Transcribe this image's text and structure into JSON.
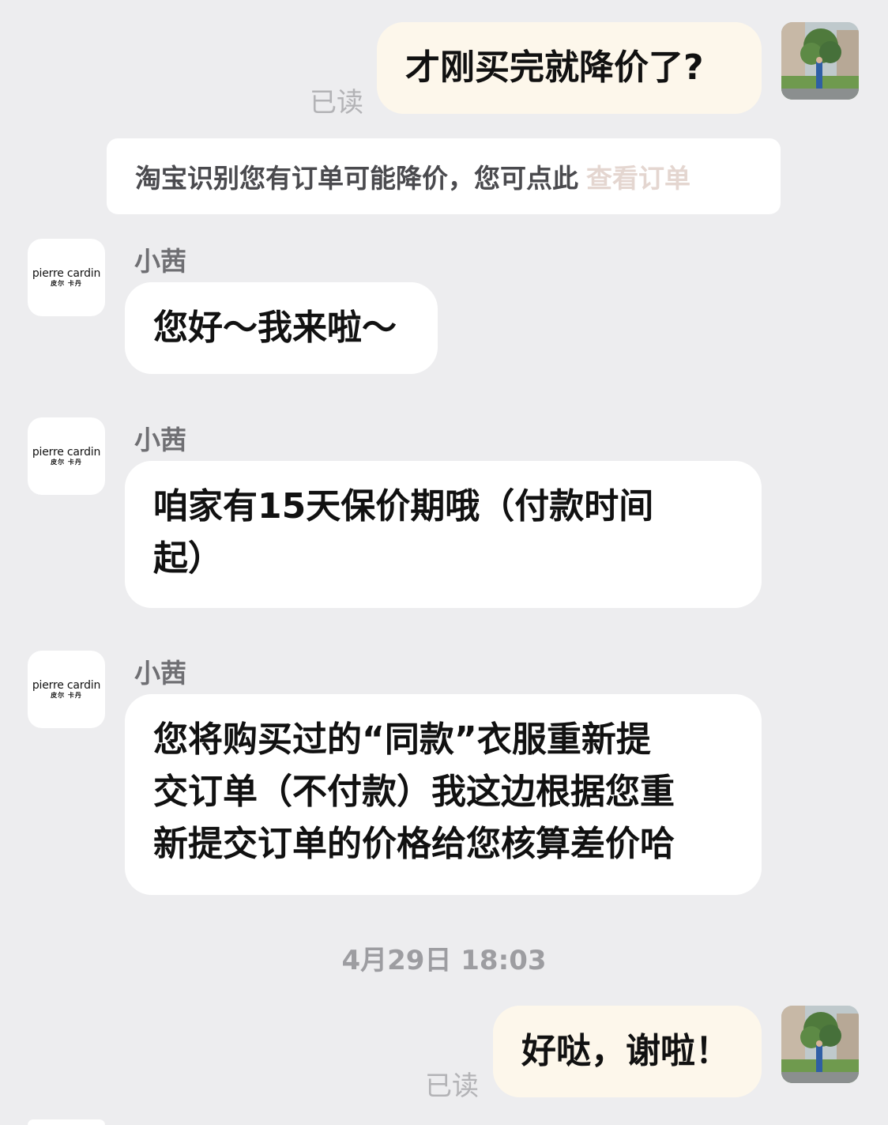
{
  "messages": {
    "m1": {
      "text": "才刚买完就降价了?",
      "status": "已读"
    },
    "notice": {
      "text": "淘宝识别您有订单可能降价，您可点此",
      "link": "查看订单"
    },
    "m2": {
      "sender": "小茜",
      "text": "您好～我来啦～"
    },
    "m3": {
      "sender": "小茜",
      "line1": "咱家有15天保价期哦（付款时间",
      "line2": "起）"
    },
    "m4": {
      "sender": "小茜",
      "line1": "您将购买过的“同款”衣服重新提",
      "line2": "交订单（不付款）我这边根据您重",
      "line3": "新提交订单的价格给您核算差价哈"
    },
    "timestamp": "4月29日 18:03",
    "m5": {
      "text": "好哒，谢啦！",
      "status": "已读"
    }
  },
  "shop_avatar": {
    "brand": "pierre cardin",
    "brand_cn": "皮尔 卡丹"
  },
  "colors": {
    "background": "#ededef",
    "outgoing_bubble": "#fdf7eb",
    "incoming_bubble": "#ffffff",
    "link": "#e4d6d0"
  }
}
